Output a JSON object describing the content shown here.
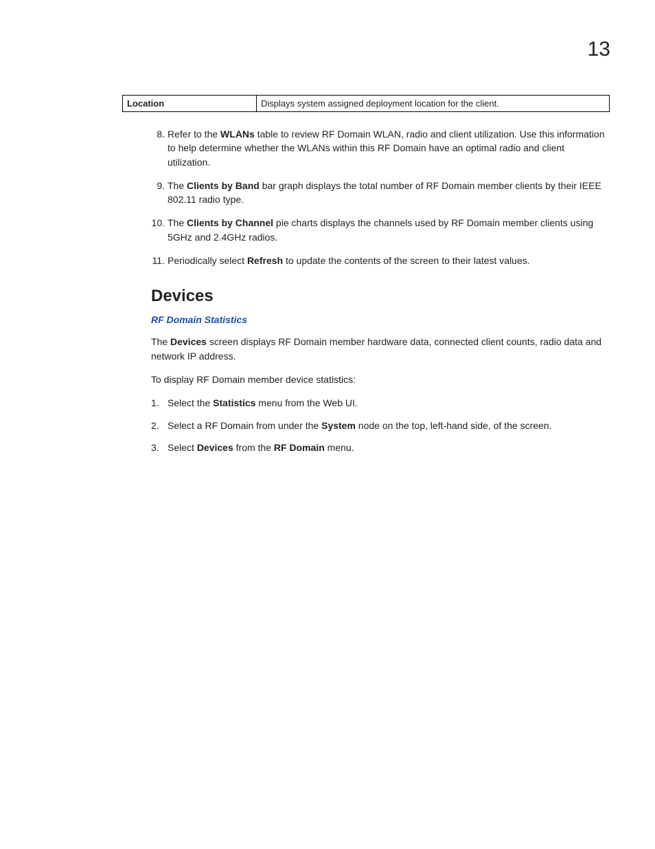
{
  "page_number": "13",
  "table": {
    "label": "Location",
    "desc": "Displays system assigned deployment location for the client."
  },
  "list_top": [
    {
      "num": "8.",
      "pre": "Refer to the ",
      "bold1": "WLANs",
      "post1": " table to review RF Domain WLAN, radio and client utilization. Use this information to help determine whether the WLANs within this RF Domain have an optimal radio and client utilization."
    },
    {
      "num": "9.",
      "pre": "The ",
      "bold1": "Clients by Band",
      "post1": " bar graph displays the total number of RF Domain member clients by their IEEE 802.11 radio type."
    },
    {
      "num": "10.",
      "pre": "The ",
      "bold1": "Clients by Channel",
      "post1": " pie charts displays the channels used by RF Domain member clients using 5GHz and 2.4GHz radios."
    },
    {
      "num": "11.",
      "pre": "Periodically select ",
      "bold1": "Refresh",
      "post1": " to update the contents of the screen to their latest values."
    }
  ],
  "section_heading": "Devices",
  "breadcrumb": "RF Domain Statistics",
  "para1_pre": "The ",
  "para1_bold": "Devices",
  "para1_post": " screen displays RF Domain member hardware data, connected client counts, radio data and network IP address.",
  "para2": "To display RF Domain member device statistics:",
  "list_steps": [
    {
      "num": "1.",
      "pre": "Select the ",
      "bold1": "Statistics",
      "post1": " menu from the Web UI."
    },
    {
      "num": "2.",
      "pre": "Select a RF Domain from under the ",
      "bold1": "System",
      "post1": " node on the top, left-hand side, of the screen."
    },
    {
      "num": "3.",
      "pre": "Select ",
      "bold1": "Devices",
      "mid": " from the ",
      "bold2": "RF Domain",
      "post1": " menu."
    }
  ]
}
